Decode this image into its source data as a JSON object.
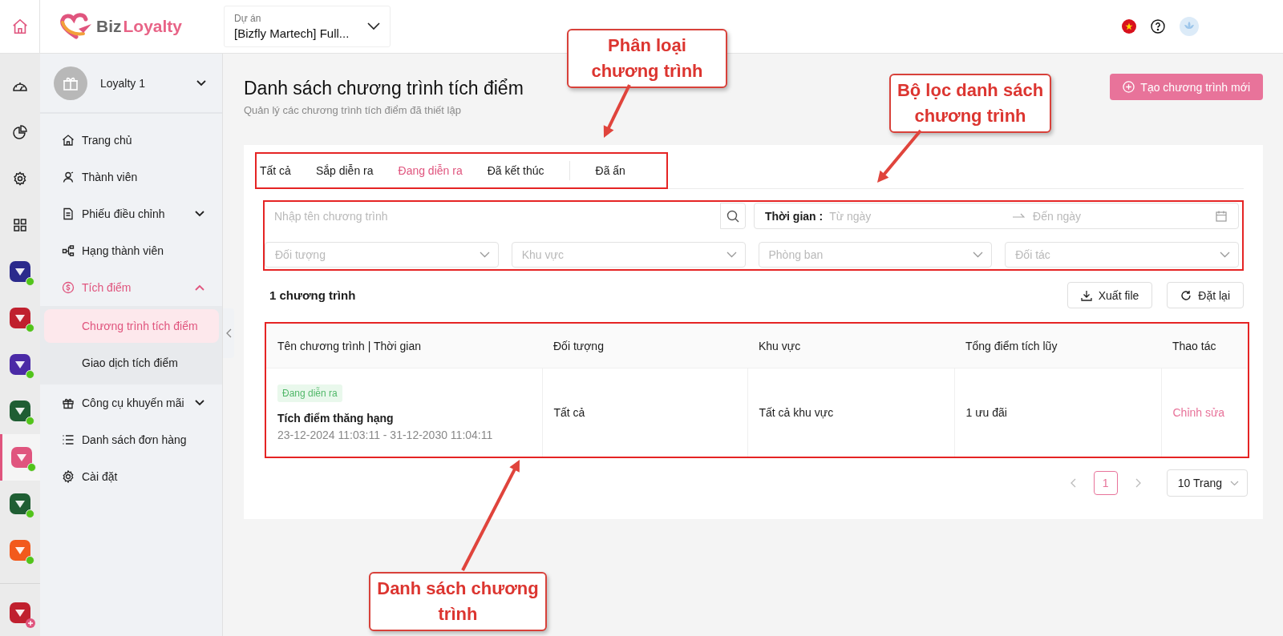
{
  "header": {
    "logo": {
      "first": "Biz",
      "second": "Loyalty"
    },
    "project_label": "Dự án",
    "project_value": "[Bizfly Martech] Full..."
  },
  "rail": {
    "tools": [
      {
        "kind": "dashboard"
      },
      {
        "kind": "chart"
      },
      {
        "kind": "settings"
      },
      {
        "kind": "grid"
      }
    ],
    "apps": [
      {
        "color": "#2b2a8c",
        "online": true,
        "selected": false
      },
      {
        "color": "#c0202e",
        "online": true,
        "selected": false
      },
      {
        "color": "#4b2aa6",
        "online": true,
        "selected": false
      },
      {
        "color": "#1f5e33",
        "online": true,
        "selected": false
      },
      {
        "color": "#e0557e",
        "online": true,
        "selected": true
      },
      {
        "color": "#1f5e33",
        "online": true,
        "selected": false
      },
      {
        "color": "#f25a1c",
        "online": true,
        "selected": false
      }
    ],
    "extra_app": {
      "color": "#c0202e",
      "selected": false
    }
  },
  "sidebar": {
    "account": "Loyalty 1",
    "items": [
      {
        "kind": "link",
        "label": "Trang chủ",
        "selected": false
      },
      {
        "kind": "link",
        "label": "Thành viên",
        "selected": false
      },
      {
        "kind": "group",
        "label": "Phiếu điều chỉnh",
        "selected": false,
        "expanded": false
      },
      {
        "kind": "link",
        "label": "Hạng thành viên",
        "selected": false
      },
      {
        "kind": "group",
        "label": "Tích điểm",
        "selected": true,
        "expanded": true,
        "children": [
          {
            "label": "Chương trình tích điểm",
            "selected": true
          },
          {
            "label": "Giao dịch tích điểm",
            "selected": false
          }
        ]
      },
      {
        "kind": "group",
        "label": "Công cụ khuyến mãi",
        "selected": false,
        "expanded": false
      },
      {
        "kind": "link",
        "label": "Danh sách đơn hàng",
        "selected": false
      },
      {
        "kind": "link",
        "label": "Cài đặt",
        "selected": false
      }
    ]
  },
  "page": {
    "title": "Danh sách chương trình tích điểm",
    "subtitle": "Quản lý các chương trình tích điểm đã thiết lập",
    "create_button": "Tạo chương trình mới"
  },
  "tabs": [
    {
      "label": "Tất cả",
      "selected": false
    },
    {
      "label": "Sắp diễn ra",
      "selected": false
    },
    {
      "label": "Đang diễn ra",
      "selected": true
    },
    {
      "label": "Đã kết thúc",
      "selected": false
    },
    {
      "label": "Đã ẩn",
      "selected": false
    }
  ],
  "filters": {
    "search_placeholder": "Nhập tên chương trình",
    "time_label": "Thời gian :",
    "from_placeholder": "Từ ngày",
    "to_placeholder": "Đến ngày",
    "selects": [
      {
        "placeholder": "Đối tượng"
      },
      {
        "placeholder": "Khu vực"
      },
      {
        "placeholder": "Phòng ban"
      },
      {
        "placeholder": "Đối tác"
      }
    ]
  },
  "results": {
    "count": "1 chương trình",
    "export_button": "Xuất file",
    "reset_button": "Đặt lại"
  },
  "table": {
    "columns": [
      "Tên chương trình | Thời gian",
      "Đối tượng",
      "Khu vực",
      "Tổng điểm tích lũy",
      "Thao tác"
    ],
    "rows": [
      {
        "status": "Đang diễn ra",
        "name": "Tích điểm thăng hạng",
        "period": "23-12-2024 11:03:11 - 31-12-2030 11:04:11",
        "target": "Tất cả",
        "region": "Tất cả khu vực",
        "total": "1 ưu đãi",
        "action": "Chỉnh sửa"
      }
    ]
  },
  "pagination": {
    "pages": [
      {
        "label": "1",
        "selected": true
      }
    ],
    "page_size": "10 Trang"
  },
  "annotations": [
    {
      "text": "Phân loại chương trình"
    },
    {
      "text": "Bộ lọc danh sách chương trình"
    },
    {
      "text": "Danh sách chương trình"
    }
  ]
}
